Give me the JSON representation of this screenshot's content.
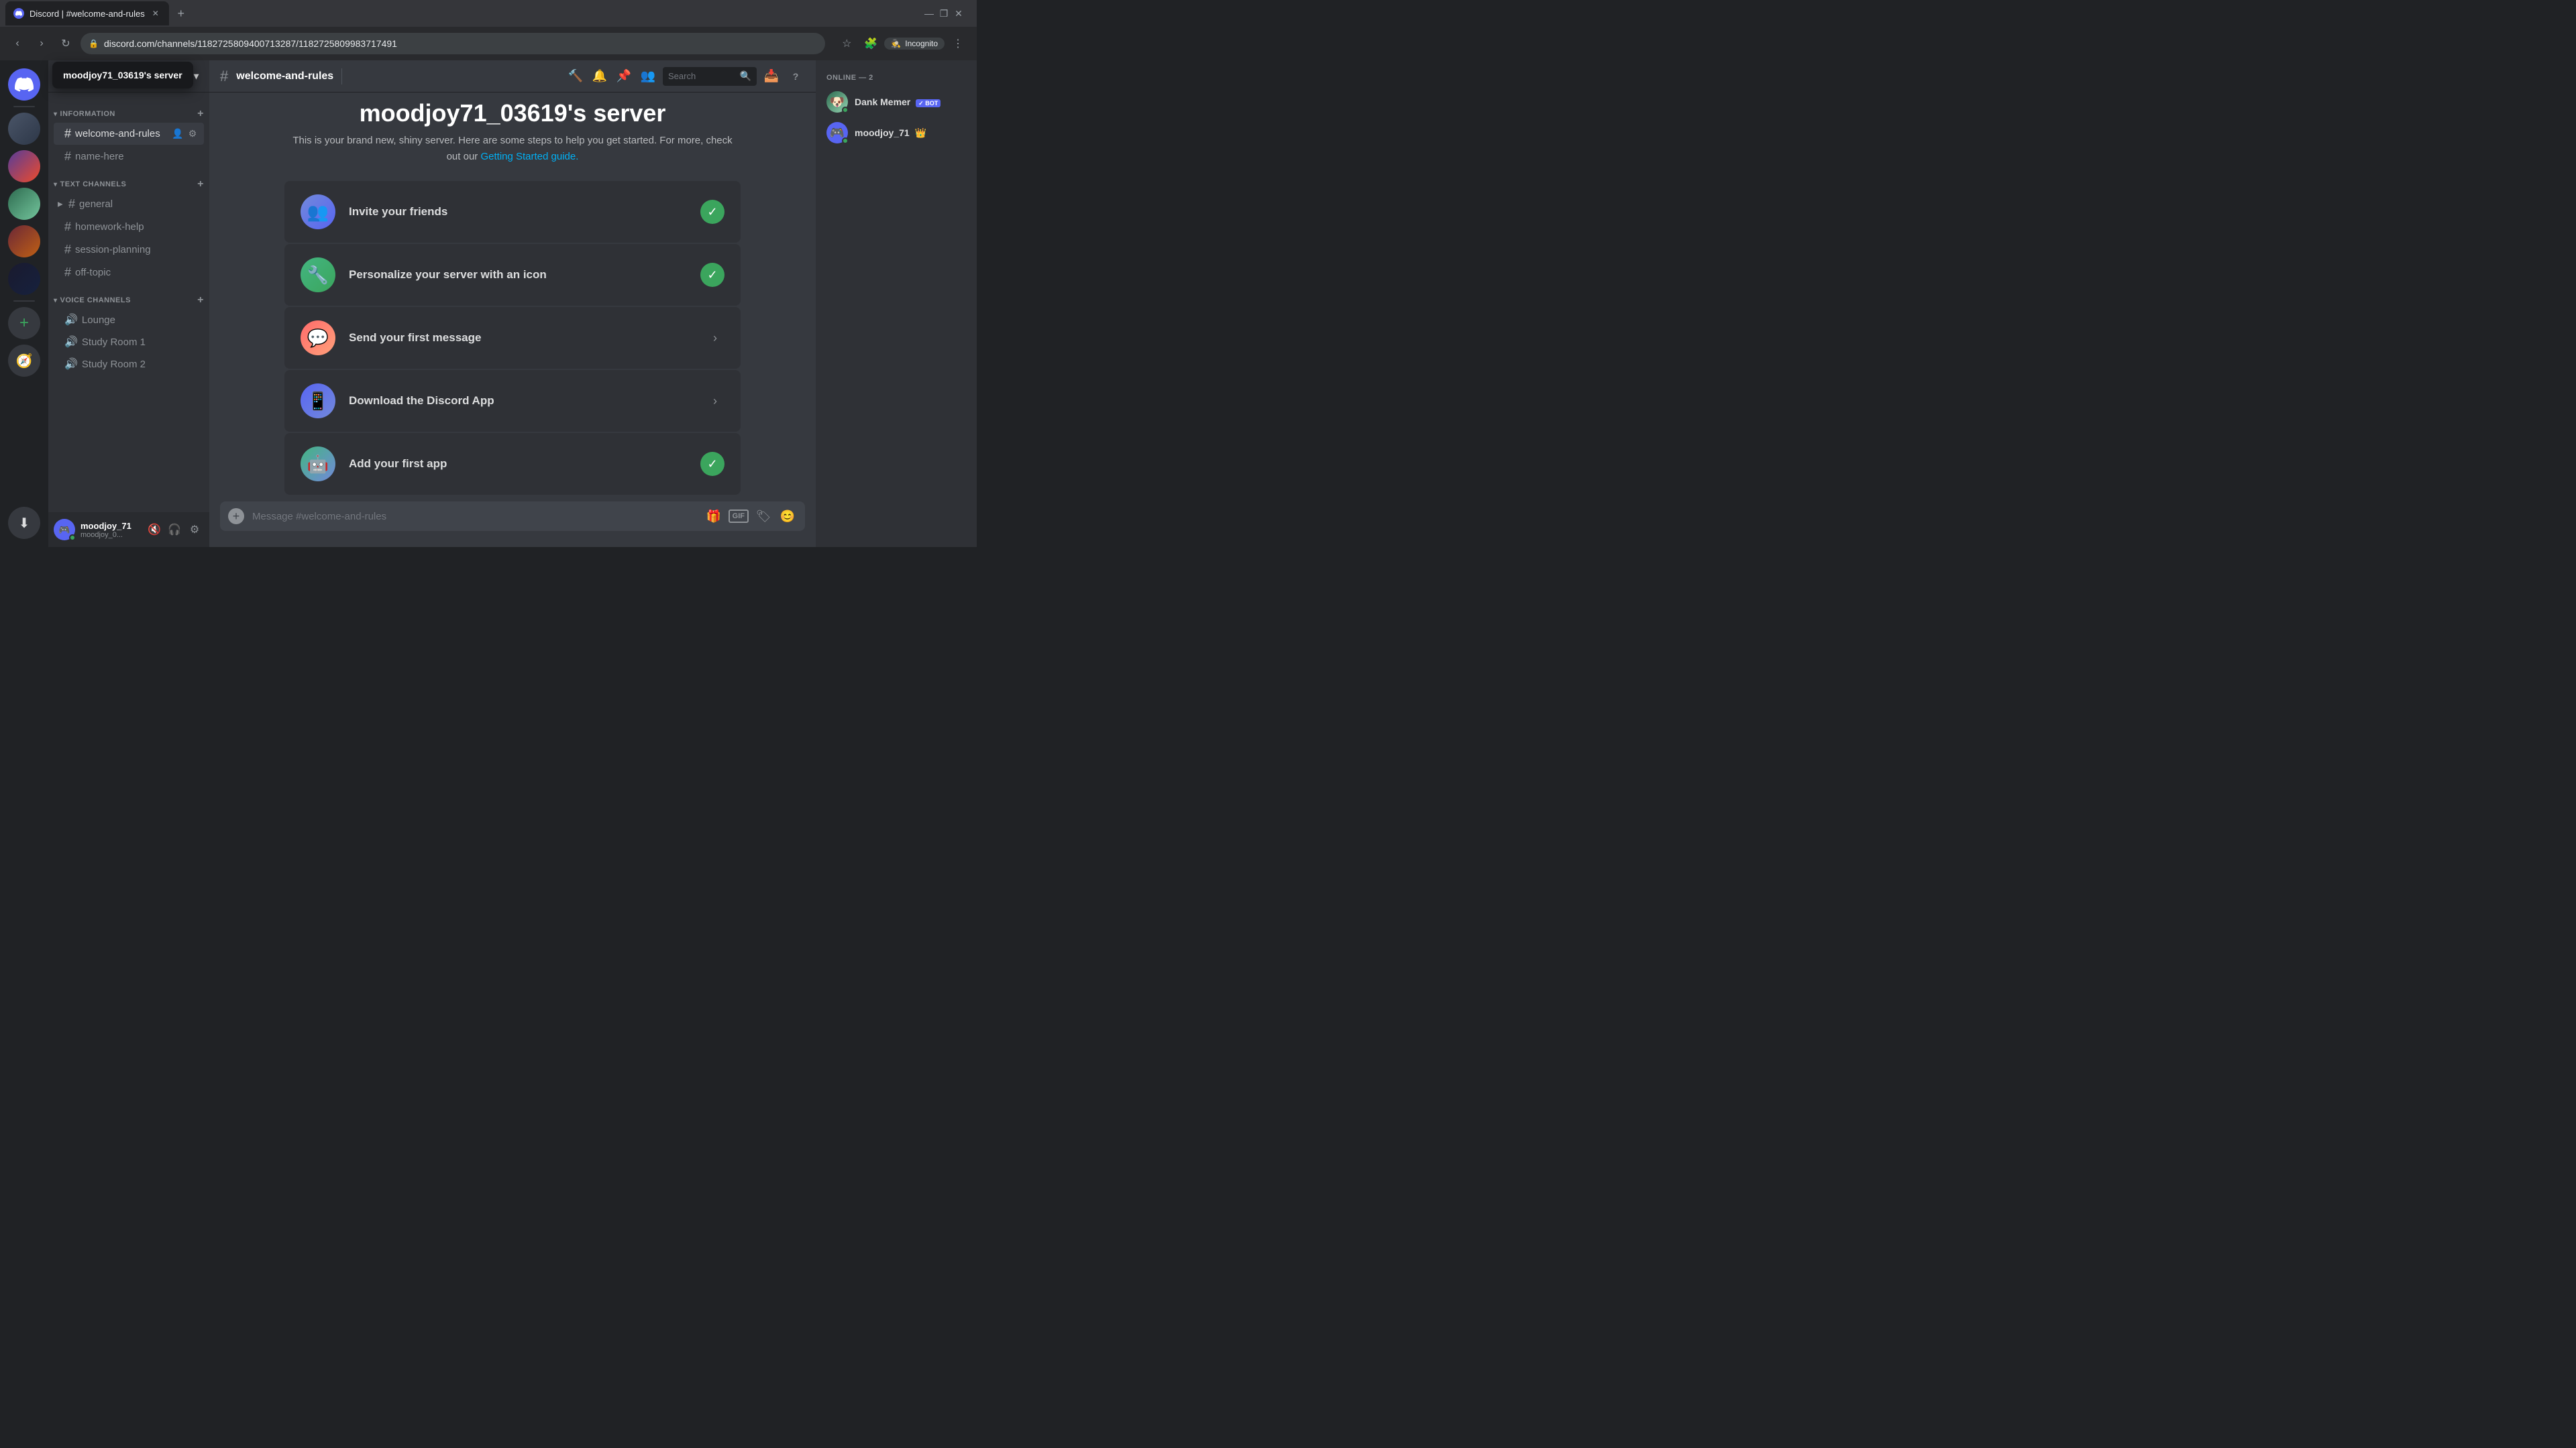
{
  "browser": {
    "tab_title": "Discord | #welcome-and-rules",
    "url": "discord.com/channels/1182725809400713287/1182725809983717491",
    "incognito_label": "Incognito"
  },
  "server": {
    "name": "moodjoy71_03619's server",
    "welcome_title": "moodjoy71_03619's server",
    "welcome_desc": "This is your brand new, shiny server. Here are some steps to help you get started. For more, check out our",
    "welcome_link": "Getting Started guide."
  },
  "sidebar": {
    "information_section": "INFORMATION",
    "text_channels_section": "TEXT CHANNELS",
    "voice_channels_section": "VOICE CHANNELS",
    "channels": [
      {
        "name": "welcome-and-rules",
        "active": true
      },
      {
        "name": "name-here",
        "active": false
      }
    ],
    "text_channels": [
      {
        "name": "general",
        "active": false
      },
      {
        "name": "homework-help",
        "active": false
      },
      {
        "name": "session-planning",
        "active": false
      },
      {
        "name": "off-topic",
        "active": false
      }
    ],
    "voice_channels": [
      {
        "name": "Lounge"
      },
      {
        "name": "Study Room 1"
      },
      {
        "name": "Study Room 2"
      }
    ]
  },
  "header": {
    "channel_name": "welcome-and-rules",
    "search_placeholder": "Search"
  },
  "checklist": [
    {
      "id": "invite",
      "label": "Invite your friends",
      "done": true,
      "icon": "👥"
    },
    {
      "id": "customize",
      "label": "Personalize your server with an icon",
      "done": true,
      "icon": "🔧"
    },
    {
      "id": "message",
      "label": "Send your first message",
      "done": false,
      "icon": "💬"
    },
    {
      "id": "download",
      "label": "Download the Discord App",
      "done": false,
      "icon": "📱"
    },
    {
      "id": "app",
      "label": "Add your first app",
      "done": true,
      "icon": "🤖"
    }
  ],
  "message_input": {
    "placeholder": "Message #welcome-and-rules"
  },
  "members": {
    "online_label": "ONLINE — 2",
    "list": [
      {
        "name": "Dank Memer",
        "is_bot": true,
        "status": "online",
        "avatar_type": "dank"
      },
      {
        "name": "moodjoy_71",
        "is_bot": false,
        "status": "online",
        "avatar_type": "user",
        "is_owner": true
      }
    ]
  },
  "user_panel": {
    "name": "moodjoy_71",
    "discriminator": "moodjoy_0..."
  },
  "icons": {
    "hash": "#",
    "speaker": "🔊",
    "checkmark": "✓",
    "arrow_right": "›",
    "plus": "+",
    "chevron_down": "▼",
    "chevron_right": "▶",
    "pin": "📌",
    "people": "👥",
    "search": "🔍",
    "inbox": "📥",
    "help": "?",
    "mute": "🔇",
    "headset": "🎧",
    "settings": "⚙",
    "gift": "🎁",
    "gif": "GIF",
    "sticker": "🏷",
    "emoji": "😊",
    "threads": "💬",
    "bell": "🔔",
    "pin_header": "📌"
  }
}
